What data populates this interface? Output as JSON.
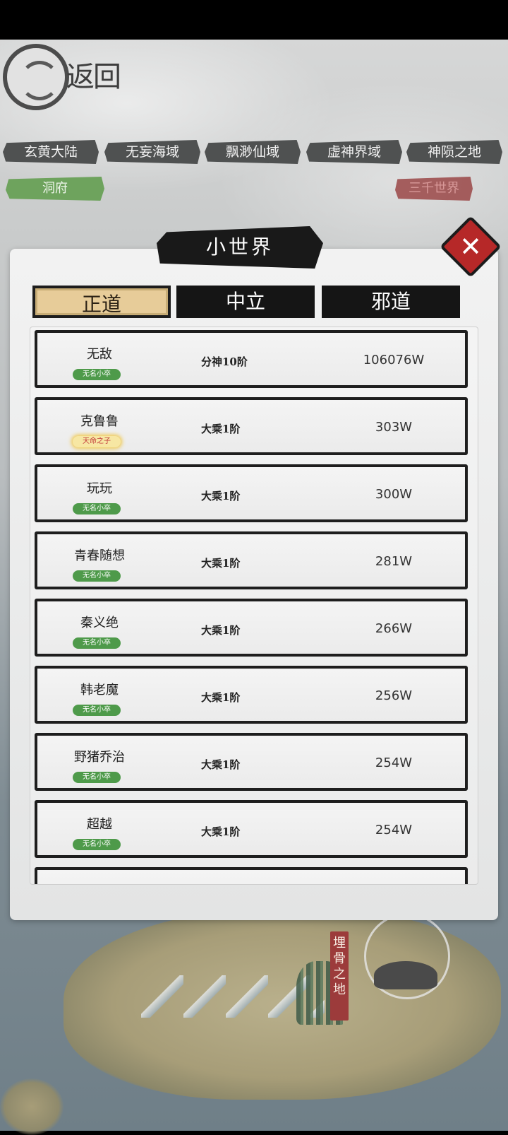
{
  "logo": {
    "text": "返回"
  },
  "regions": [
    "玄黄大陆",
    "无妄海域",
    "飘渺仙域",
    "虚神界域",
    "神陨之地"
  ],
  "pills": {
    "left": "洞府",
    "right": "三千世界"
  },
  "map": {
    "banner": "埋骨之地"
  },
  "modal": {
    "title": "小世界",
    "close_label": "✕",
    "tabs": [
      "正道",
      "中立",
      "邪道"
    ],
    "active_tab": "正道"
  },
  "rows": [
    {
      "name": "无敌",
      "badge": "无名小卒",
      "badge_type": "green",
      "rank": "分神10阶",
      "power": "106076W"
    },
    {
      "name": "克鲁鲁",
      "badge": "天命之子",
      "badge_type": "gold",
      "rank": "大乘1阶",
      "power": "303W"
    },
    {
      "name": "玩玩",
      "badge": "无名小卒",
      "badge_type": "green",
      "rank": "大乘1阶",
      "power": "300W"
    },
    {
      "name": "青春随想",
      "badge": "无名小卒",
      "badge_type": "green",
      "rank": "大乘1阶",
      "power": "281W"
    },
    {
      "name": "秦义绝",
      "badge": "无名小卒",
      "badge_type": "green",
      "rank": "大乘1阶",
      "power": "266W"
    },
    {
      "name": "韩老魔",
      "badge": "无名小卒",
      "badge_type": "green",
      "rank": "大乘1阶",
      "power": "256W"
    },
    {
      "name": "野猪乔治",
      "badge": "无名小卒",
      "badge_type": "green",
      "rank": "大乘1阶",
      "power": "254W"
    },
    {
      "name": "超越",
      "badge": "无名小卒",
      "badge_type": "green",
      "rank": "大乘1阶",
      "power": "254W"
    }
  ],
  "colors": {
    "badge_green": "#4e9a4a",
    "active_tab": "#e7cc99",
    "close": "#b62828"
  }
}
